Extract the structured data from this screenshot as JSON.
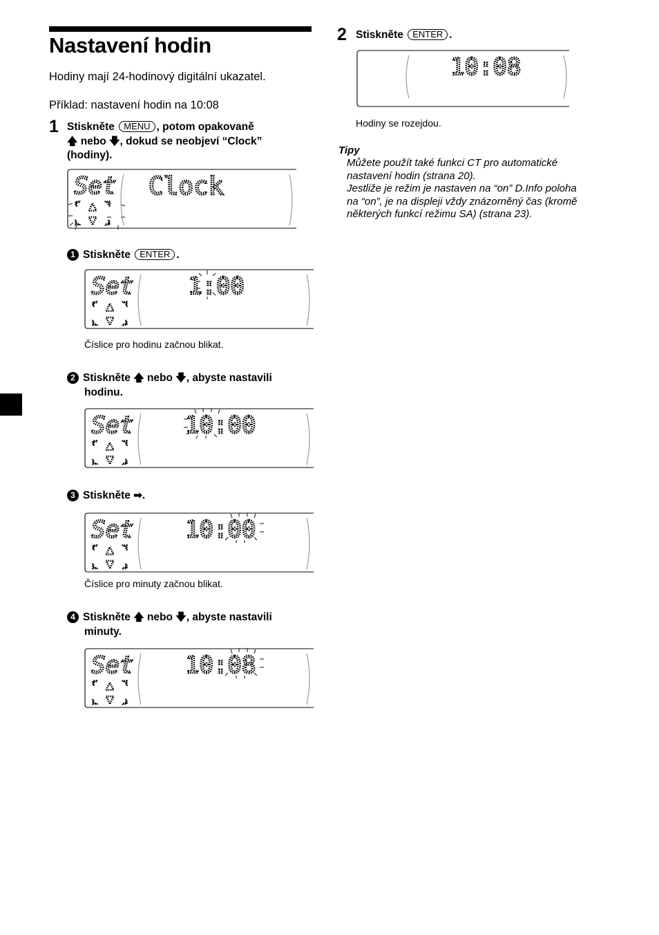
{
  "page": {
    "title": "Nastavení hodin",
    "intro": "Hodiny mají 24-hodinový digitální ukazatel.",
    "example": "Příklad: nastavení hodin na 10:08"
  },
  "step1": {
    "number": "1",
    "text_a": "Stiskněte",
    "key": "MENU",
    "text_b": ", potom opakovaně",
    "arrow_up": "🡅",
    "text_c": " nebo ",
    "arrow_down": "🡇",
    "text_d": ", dokud se neobjeví “Clock”",
    "text_e": "(hodiny).",
    "display": {
      "left": "Set",
      "main": "Clock"
    }
  },
  "substeps": [
    {
      "marker": "1",
      "text_a": "Stiskněte",
      "key": "ENTER",
      "text_b": ".",
      "display": {
        "left": "Set",
        "main": "1:00",
        "blink": "hours"
      },
      "caption": "Číslice pro hodinu začnou blikat."
    },
    {
      "marker": "2",
      "text_a": "Stiskněte",
      "arrow_up": "🡅",
      "text_b": " nebo ",
      "arrow_down": "🡇",
      "text_c": ", abyste nastavili",
      "text_d": "hodinu.",
      "display": {
        "left": "Set",
        "main": "10:00",
        "blink": "hours"
      }
    },
    {
      "marker": "3",
      "text_a": "Stiskněte",
      "arrow_right": "➡",
      "text_b": ".",
      "display": {
        "left": "Set",
        "main": "10:00",
        "blink": "minutes"
      },
      "caption": "Číslice pro minuty začnou blikat."
    },
    {
      "marker": "4",
      "text_a": "Stiskněte",
      "arrow_up": "🡅",
      "text_b": " nebo ",
      "arrow_down": "🡇",
      "text_c": ", abyste nastavili",
      "text_d": "minuty.",
      "display": {
        "left": "Set",
        "main": "10:08",
        "blink": "minutes"
      }
    }
  ],
  "step2": {
    "number": "2",
    "text_a": "Stiskněte",
    "key": "ENTER",
    "text_b": ".",
    "display": {
      "main": "10:08"
    },
    "caption": "Hodiny se rozejdou."
  },
  "tips": {
    "heading": "Tipy",
    "lines": [
      "Můžete použít také funkci CT pro automatické",
      "nastavení hodin (strana 20).",
      "Jestliže je režim je nastaven na “on” D.Info poloha",
      "na “on”, je na displeji vždy znázorněný čas (kromě",
      "některých funkcí režimu SA) (strana 23)."
    ]
  }
}
